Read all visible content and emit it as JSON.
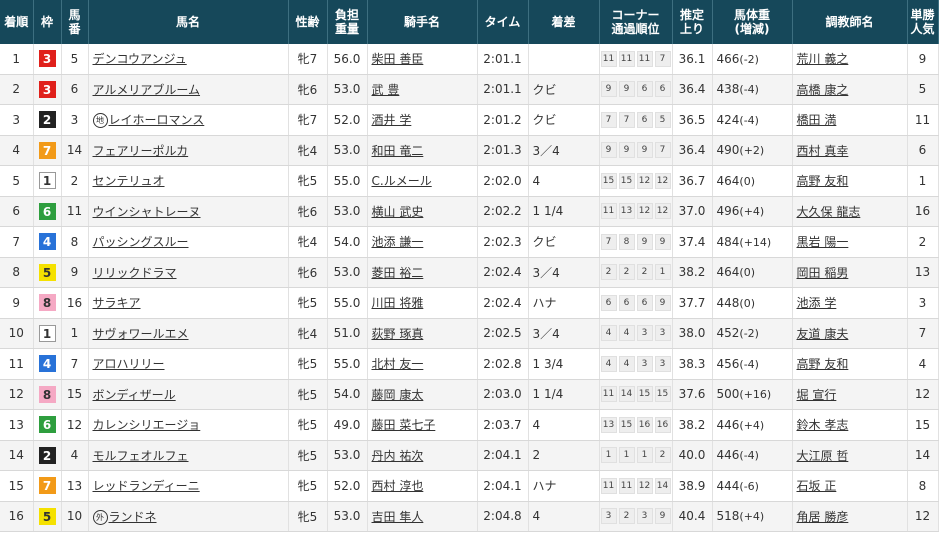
{
  "headers": {
    "rank": "着順",
    "waku": "枠",
    "umaban": [
      "馬",
      "番"
    ],
    "horse": "馬名",
    "sexage": "性齢",
    "burden": [
      "負担",
      "重量"
    ],
    "jockey": "騎手名",
    "time": "タイム",
    "margin": "着差",
    "corner": [
      "コーナー",
      "通過順位"
    ],
    "last3f": [
      "推定",
      "上り"
    ],
    "weight": [
      "馬体重",
      "(増減)"
    ],
    "trainer": "調教師名",
    "pop": [
      "単勝",
      "人気"
    ]
  },
  "waku_colors": {
    "1": {
      "bg": "#ffffff",
      "fg": "#333333",
      "border": "#999999"
    },
    "2": {
      "bg": "#222222",
      "fg": "#ffffff",
      "border": "#222222"
    },
    "3": {
      "bg": "#e0201b",
      "fg": "#ffffff",
      "border": "#e0201b"
    },
    "4": {
      "bg": "#2872d8",
      "fg": "#ffffff",
      "border": "#2872d8"
    },
    "5": {
      "bg": "#f5e100",
      "fg": "#333333",
      "border": "#f5e100"
    },
    "6": {
      "bg": "#2e9e3e",
      "fg": "#ffffff",
      "border": "#2e9e3e"
    },
    "7": {
      "bg": "#f29a18",
      "fg": "#ffffff",
      "border": "#f29a18"
    },
    "8": {
      "bg": "#f5a9c4",
      "fg": "#333333",
      "border": "#f5a9c4"
    }
  },
  "rows": [
    {
      "rank": "1",
      "waku": "3",
      "umaban": "5",
      "mark": "",
      "horse": "デンコウアンジュ",
      "sexage": "牝7",
      "burden": "56.0",
      "jockey": "柴田 善臣",
      "time": "2:01.1",
      "margin": "",
      "corner": [
        "11",
        "11",
        "11",
        "7"
      ],
      "last3f": "36.1",
      "weight": "466",
      "weight_diff": "(-2)",
      "trainer": "荒川 義之",
      "pop": "9"
    },
    {
      "rank": "2",
      "waku": "3",
      "umaban": "6",
      "mark": "",
      "horse": "アルメリアブルーム",
      "sexage": "牝6",
      "burden": "53.0",
      "jockey": "武 豊",
      "time": "2:01.1",
      "margin": "クビ",
      "corner": [
        "9",
        "9",
        "6",
        "6"
      ],
      "last3f": "36.4",
      "weight": "438",
      "weight_diff": "(-4)",
      "trainer": "高橋 康之",
      "pop": "5"
    },
    {
      "rank": "3",
      "waku": "2",
      "umaban": "3",
      "mark": "地",
      "horse": "レイホーロマンス",
      "sexage": "牝7",
      "burden": "52.0",
      "jockey": "酒井 学",
      "time": "2:01.2",
      "margin": "クビ",
      "corner": [
        "7",
        "7",
        "6",
        "5"
      ],
      "last3f": "36.5",
      "weight": "424",
      "weight_diff": "(-4)",
      "trainer": "橋田 満",
      "pop": "11"
    },
    {
      "rank": "4",
      "waku": "7",
      "umaban": "14",
      "mark": "",
      "horse": "フェアリーポルカ",
      "sexage": "牝4",
      "burden": "53.0",
      "jockey": "和田 竜二",
      "time": "2:01.3",
      "margin": "3／4",
      "corner": [
        "9",
        "9",
        "9",
        "7"
      ],
      "last3f": "36.4",
      "weight": "490",
      "weight_diff": "(+2)",
      "trainer": "西村 真幸",
      "pop": "6"
    },
    {
      "rank": "5",
      "waku": "1",
      "umaban": "2",
      "mark": "",
      "horse": "センテリュオ",
      "sexage": "牝5",
      "burden": "55.0",
      "jockey": "C.ルメール",
      "time": "2:02.0",
      "margin": "4",
      "corner": [
        "15",
        "15",
        "12",
        "12"
      ],
      "last3f": "36.7",
      "weight": "464",
      "weight_diff": "(0)",
      "trainer": "高野 友和",
      "pop": "1"
    },
    {
      "rank": "6",
      "waku": "6",
      "umaban": "11",
      "mark": "",
      "horse": "ウインシャトレーヌ",
      "sexage": "牝6",
      "burden": "53.0",
      "jockey": "横山 武史",
      "time": "2:02.2",
      "margin": "1 1/4",
      "corner": [
        "11",
        "13",
        "12",
        "12"
      ],
      "last3f": "37.0",
      "weight": "496",
      "weight_diff": "(+4)",
      "trainer": "大久保 龍志",
      "pop": "16"
    },
    {
      "rank": "7",
      "waku": "4",
      "umaban": "8",
      "mark": "",
      "horse": "パッシングスルー",
      "sexage": "牝4",
      "burden": "54.0",
      "jockey": "池添 謙一",
      "time": "2:02.3",
      "margin": "クビ",
      "corner": [
        "7",
        "8",
        "9",
        "9"
      ],
      "last3f": "37.4",
      "weight": "484",
      "weight_diff": "(+14)",
      "trainer": "黒岩 陽一",
      "pop": "2"
    },
    {
      "rank": "8",
      "waku": "5",
      "umaban": "9",
      "mark": "",
      "horse": "リリックドラマ",
      "sexage": "牝6",
      "burden": "53.0",
      "jockey": "菱田 裕二",
      "time": "2:02.4",
      "margin": "3／4",
      "corner": [
        "2",
        "2",
        "2",
        "1"
      ],
      "last3f": "38.2",
      "weight": "464",
      "weight_diff": "(0)",
      "trainer": "岡田 稲男",
      "pop": "13"
    },
    {
      "rank": "9",
      "waku": "8",
      "umaban": "16",
      "mark": "",
      "horse": "サラキア",
      "sexage": "牝5",
      "burden": "55.0",
      "jockey": "川田 将雅",
      "time": "2:02.4",
      "margin": "ハナ",
      "corner": [
        "6",
        "6",
        "6",
        "9"
      ],
      "last3f": "37.7",
      "weight": "448",
      "weight_diff": "(0)",
      "trainer": "池添 学",
      "pop": "3"
    },
    {
      "rank": "10",
      "waku": "1",
      "umaban": "1",
      "mark": "",
      "horse": "サヴォワールエメ",
      "sexage": "牝4",
      "burden": "51.0",
      "jockey": "荻野 琢真",
      "time": "2:02.5",
      "margin": "3／4",
      "corner": [
        "4",
        "4",
        "3",
        "3"
      ],
      "last3f": "38.0",
      "weight": "452",
      "weight_diff": "(-2)",
      "trainer": "友道 康夫",
      "pop": "7"
    },
    {
      "rank": "11",
      "waku": "4",
      "umaban": "7",
      "mark": "",
      "horse": "アロハリリー",
      "sexage": "牝5",
      "burden": "55.0",
      "jockey": "北村 友一",
      "time": "2:02.8",
      "margin": "1 3/4",
      "corner": [
        "4",
        "4",
        "3",
        "3"
      ],
      "last3f": "38.3",
      "weight": "456",
      "weight_diff": "(-4)",
      "trainer": "高野 友和",
      "pop": "4"
    },
    {
      "rank": "12",
      "waku": "8",
      "umaban": "15",
      "mark": "",
      "horse": "ボンディザール",
      "sexage": "牝5",
      "burden": "54.0",
      "jockey": "藤岡 康太",
      "time": "2:03.0",
      "margin": "1 1/4",
      "corner": [
        "11",
        "14",
        "15",
        "15"
      ],
      "last3f": "37.6",
      "weight": "500",
      "weight_diff": "(+16)",
      "trainer": "堀 宣行",
      "pop": "12"
    },
    {
      "rank": "13",
      "waku": "6",
      "umaban": "12",
      "mark": "",
      "horse": "カレンシリエージョ",
      "sexage": "牝5",
      "burden": "49.0",
      "jockey": "藤田 菜七子",
      "time": "2:03.7",
      "margin": "4",
      "corner": [
        "13",
        "15",
        "16",
        "16"
      ],
      "last3f": "38.2",
      "weight": "446",
      "weight_diff": "(+4)",
      "trainer": "鈴木 孝志",
      "pop": "15"
    },
    {
      "rank": "14",
      "waku": "2",
      "umaban": "4",
      "mark": "",
      "horse": "モルフェオルフェ",
      "sexage": "牝5",
      "burden": "53.0",
      "jockey": "丹内 祐次",
      "time": "2:04.1",
      "margin": "2",
      "corner": [
        "1",
        "1",
        "1",
        "2"
      ],
      "last3f": "40.0",
      "weight": "446",
      "weight_diff": "(-4)",
      "trainer": "大江原 哲",
      "pop": "14"
    },
    {
      "rank": "15",
      "waku": "7",
      "umaban": "13",
      "mark": "",
      "horse": "レッドランディーニ",
      "sexage": "牝5",
      "burden": "52.0",
      "jockey": "西村 淳也",
      "time": "2:04.1",
      "margin": "ハナ",
      "corner": [
        "11",
        "11",
        "12",
        "14"
      ],
      "last3f": "38.9",
      "weight": "444",
      "weight_diff": "(-6)",
      "trainer": "石坂 正",
      "pop": "8"
    },
    {
      "rank": "16",
      "waku": "5",
      "umaban": "10",
      "mark": "外",
      "horse": "ランドネ",
      "sexage": "牝5",
      "burden": "53.0",
      "jockey": "吉田 隼人",
      "time": "2:04.8",
      "margin": "4",
      "corner": [
        "3",
        "2",
        "3",
        "9"
      ],
      "last3f": "40.4",
      "weight": "518",
      "weight_diff": "(+4)",
      "trainer": "角居 勝彦",
      "pop": "12"
    }
  ]
}
